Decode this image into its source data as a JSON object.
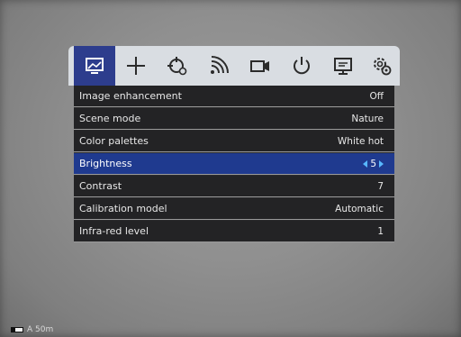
{
  "toolbar": {
    "tabs": [
      {
        "icon": "image-settings-icon",
        "active": true
      },
      {
        "icon": "crosshair-icon",
        "active": false
      },
      {
        "icon": "target-settings-icon",
        "active": false
      },
      {
        "icon": "wifi-icon",
        "active": false
      },
      {
        "icon": "video-camera-icon",
        "active": false
      },
      {
        "icon": "power-icon",
        "active": false
      },
      {
        "icon": "display-icon",
        "active": false
      },
      {
        "icon": "gear-icon",
        "active": false
      }
    ]
  },
  "menu": {
    "items": [
      {
        "label": "Image enhancement",
        "value": "Off"
      },
      {
        "label": "Scene mode",
        "value": "Nature"
      },
      {
        "label": "Color palettes",
        "value": "White hot"
      },
      {
        "label": "Brightness",
        "value": "5",
        "selected": true
      },
      {
        "label": "Contrast",
        "value": "7"
      },
      {
        "label": "Calibration model",
        "value": "Automatic"
      },
      {
        "label": "Infra-red level",
        "value": "1"
      }
    ]
  },
  "status": {
    "text": "A 50m",
    "battery_level": 0.35
  },
  "colors": {
    "active_tab": "#2d3d8d",
    "selected_row": "#1f3a8f",
    "arrow_accent": "#58b8ff"
  }
}
